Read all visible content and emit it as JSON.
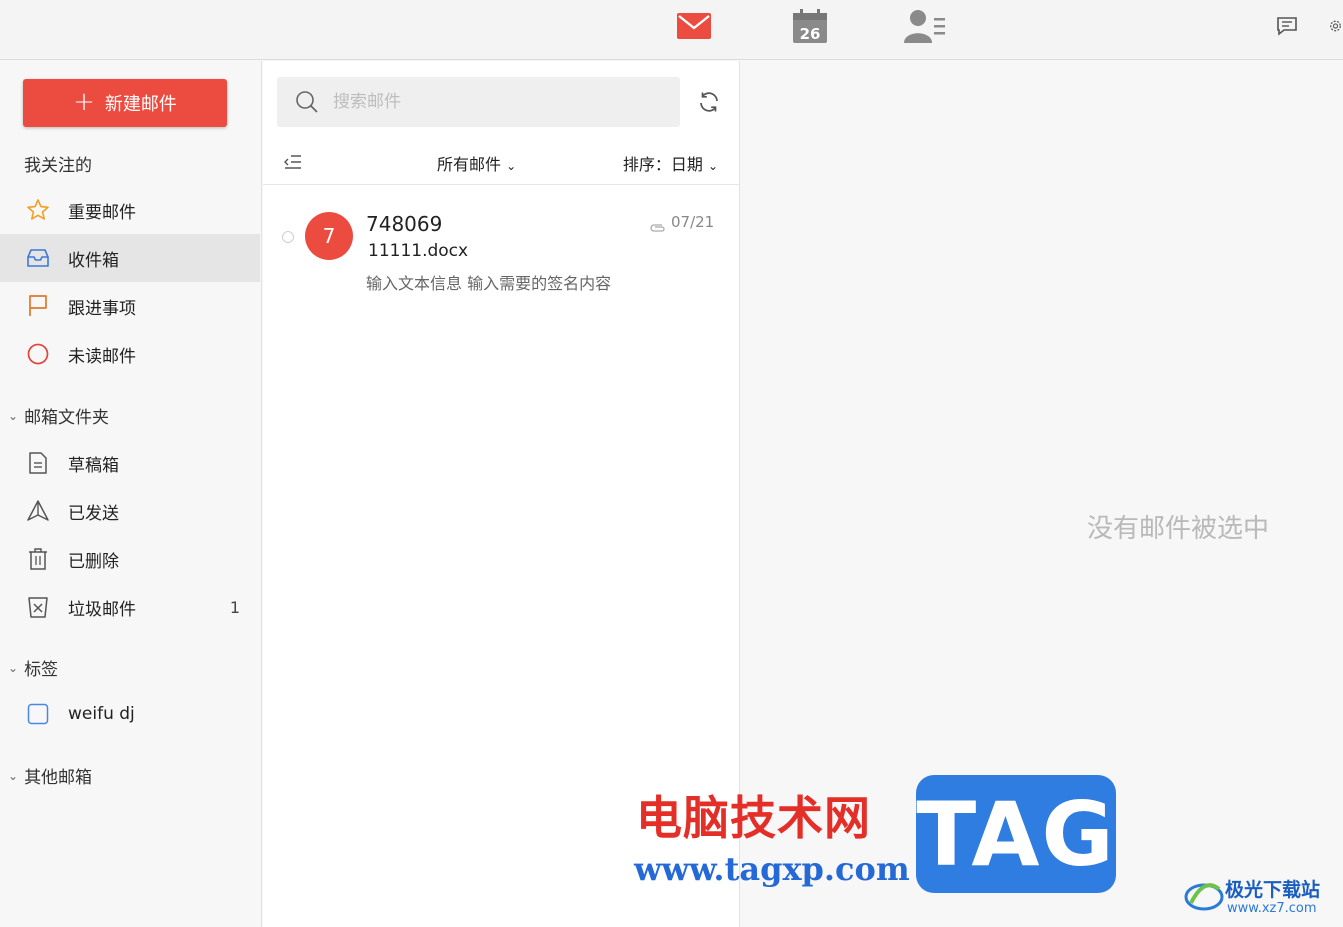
{
  "topbar": {
    "mail_icon": "envelope-icon",
    "calendar_icon": "calendar-icon",
    "calendar_day": "26",
    "contacts_icon": "contacts-icon",
    "chat_icon": "chat-icon",
    "settings_icon": "gear-icon",
    "accent": "#ec4b40"
  },
  "sidebar": {
    "compose_label": "新建邮件",
    "favorites_label": "我关注的",
    "favorites": [
      {
        "label": "重要邮件",
        "icon": "star-icon"
      },
      {
        "label": "收件箱",
        "icon": "inbox-icon",
        "active": true
      },
      {
        "label": "跟进事项",
        "icon": "flag-icon"
      },
      {
        "label": "未读邮件",
        "icon": "unread-circle-icon"
      }
    ],
    "folders_label": "邮箱文件夹",
    "folders": [
      {
        "label": "草稿箱",
        "icon": "draft-icon"
      },
      {
        "label": "已发送",
        "icon": "sent-icon"
      },
      {
        "label": "已删除",
        "icon": "trash-icon"
      },
      {
        "label": "垃圾邮件",
        "icon": "spam-icon",
        "count": "1"
      }
    ],
    "tags_label": "标签",
    "tags": [
      {
        "label": "weifu dj",
        "icon": "tag-checkbox-icon"
      }
    ],
    "other_label": "其他邮箱"
  },
  "list": {
    "search_placeholder": "搜索邮件",
    "filter_label": "所有邮件",
    "sort_label": "排序：日期",
    "items": [
      {
        "avatar": "7",
        "sender": "748069",
        "subject": "11111.docx",
        "preview": "输入文本信息 输入需要的签名内容",
        "date": "07/21",
        "has_attachment": true
      }
    ]
  },
  "reader": {
    "empty_text": "没有邮件被选中"
  },
  "watermark": {
    "site_cn": "电脑技术网",
    "site_url": "www.tagxp.com",
    "tag": "TAG",
    "xz_cn": "极光下载站",
    "xz_url": "www.xz7.com"
  }
}
